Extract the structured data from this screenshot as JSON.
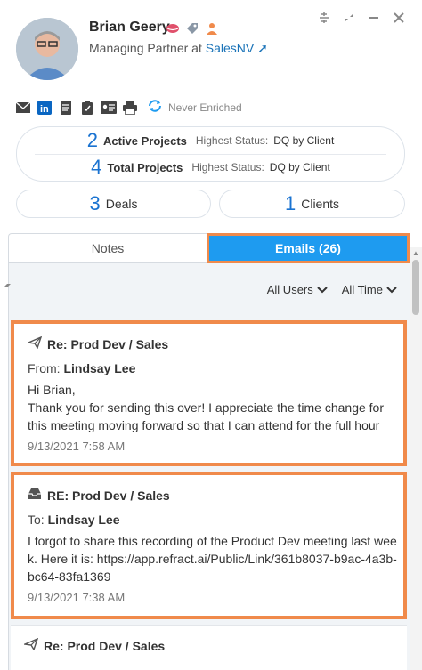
{
  "contact": {
    "name": "Brian Geery",
    "title_prefix": "Managing Partner at ",
    "company": "SalesNV",
    "enrich_status": "Never Enriched"
  },
  "projects": {
    "active_count": "2",
    "active_label": "Active Projects",
    "total_count": "4",
    "total_label": "Total Projects",
    "status_label": "Highest Status:",
    "active_status_value": "DQ by Client",
    "total_status_value": "DQ by Client"
  },
  "summary": {
    "deals_count": "3",
    "deals_label": "Deals",
    "clients_count": "1",
    "clients_label": "Clients"
  },
  "tabs": {
    "notes": "Notes",
    "emails": "Emails (26)"
  },
  "filters": {
    "users": "All Users",
    "time": "All Time"
  },
  "emails": [
    {
      "subject": "Re: Prod Dev / Sales",
      "meta_label": "From:",
      "meta_name": "Lindsay Lee",
      "body": "Hi Brian,\nThank you for sending this over! I appreciate the time change for this meeting moving forward so that I can attend for the full hour next t",
      "time": "9/13/2021 7:58 AM"
    },
    {
      "subject": "RE: Prod Dev / Sales",
      "meta_label": "To:",
      "meta_name": "Lindsay Lee",
      "body": "I forgot to share this recording of the Product Dev meeting last week. Here it is: https://app.refract.ai/Public/Link/361b8037-b9ac-4a3b-bc64-83fa1369",
      "time": "9/13/2021 7:38 AM"
    },
    {
      "subject": "Re: Prod Dev / Sales"
    }
  ],
  "colors": {
    "accent": "#1e9bf0",
    "highlight": "#f08a4b",
    "link": "#1a73b8"
  }
}
